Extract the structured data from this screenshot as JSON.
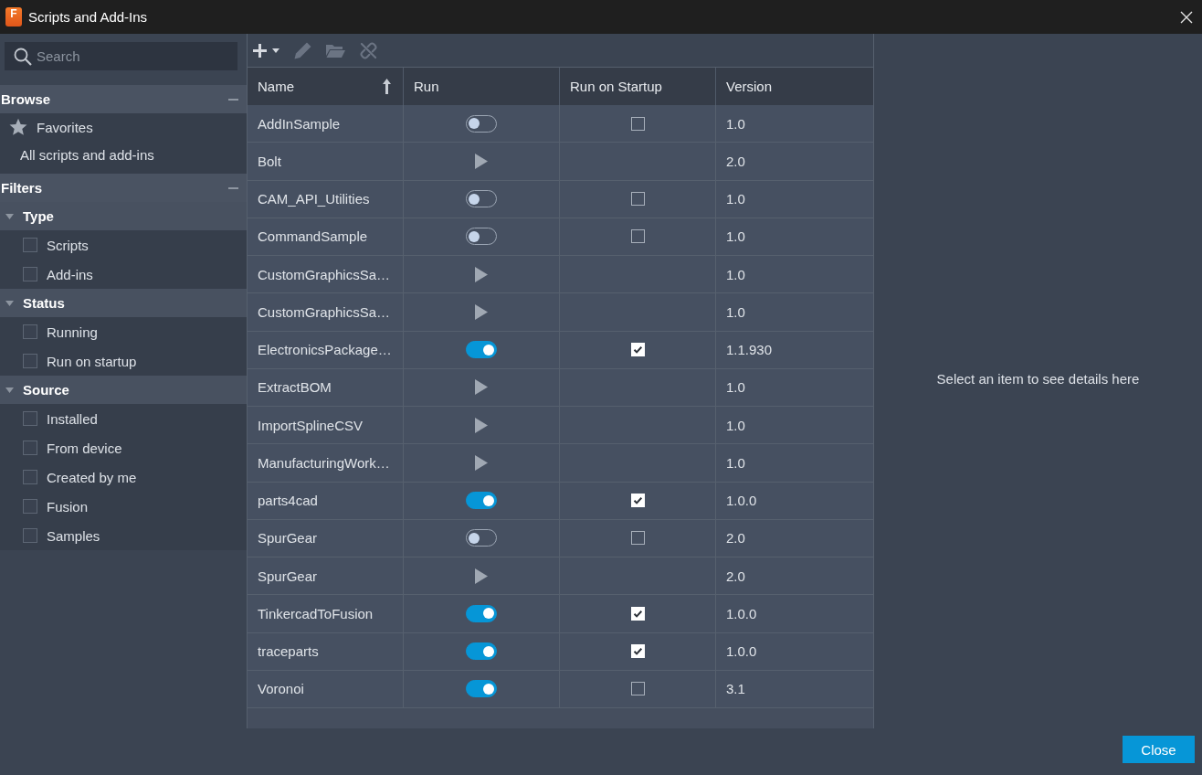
{
  "window": {
    "title": "Scripts and Add-Ins",
    "app_icon_letter": "F"
  },
  "sidebar": {
    "search": {
      "placeholder": "Search"
    },
    "browse": {
      "title": "Browse",
      "expanded": true,
      "items": [
        {
          "label": "Favorites",
          "kind": "favorites"
        },
        {
          "label": "All scripts and add-ins",
          "kind": "all"
        }
      ]
    },
    "filters": {
      "title": "Filters",
      "expanded": true,
      "groups": [
        {
          "title": "Type",
          "expanded": true,
          "items": [
            {
              "label": "Scripts",
              "checked": false
            },
            {
              "label": "Add-ins",
              "checked": false
            }
          ]
        },
        {
          "title": "Status",
          "expanded": true,
          "items": [
            {
              "label": "Running",
              "checked": false
            },
            {
              "label": "Run on startup",
              "checked": false
            }
          ]
        },
        {
          "title": "Source",
          "expanded": true,
          "items": [
            {
              "label": "Installed",
              "checked": false
            },
            {
              "label": "From device",
              "checked": false
            },
            {
              "label": "Created by me",
              "checked": false
            },
            {
              "label": "Fusion",
              "checked": false
            },
            {
              "label": "Samples",
              "checked": false
            }
          ]
        }
      ]
    }
  },
  "toolbar": {
    "buttons": [
      {
        "kind": "add",
        "disabled": false
      },
      {
        "kind": "edit",
        "disabled": true
      },
      {
        "kind": "open",
        "disabled": true
      },
      {
        "kind": "unlink",
        "disabled": true
      }
    ]
  },
  "table": {
    "columns": [
      {
        "label": "Name",
        "sorted": true
      },
      {
        "label": "Run",
        "sorted": false
      },
      {
        "label": "Run on Startup",
        "sorted": false
      },
      {
        "label": "Version",
        "sorted": false
      }
    ],
    "rows": [
      {
        "name": "AddInSample",
        "kind": "addin",
        "running": false,
        "run_on_startup": false,
        "version": "1.0"
      },
      {
        "name": "Bolt",
        "kind": "script",
        "version": "2.0"
      },
      {
        "name": "CAM_API_Utilities",
        "kind": "addin",
        "running": false,
        "run_on_startup": false,
        "version": "1.0"
      },
      {
        "name": "CommandSample",
        "kind": "addin",
        "running": false,
        "run_on_startup": false,
        "version": "1.0"
      },
      {
        "name": "CustomGraphicsSa…",
        "kind": "script",
        "version": "1.0"
      },
      {
        "name": "CustomGraphicsSa…",
        "kind": "script",
        "version": "1.0"
      },
      {
        "name": "ElectronicsPackage…",
        "kind": "addin",
        "running": true,
        "run_on_startup": true,
        "version": "1.1.930"
      },
      {
        "name": "ExtractBOM",
        "kind": "script",
        "version": "1.0"
      },
      {
        "name": "ImportSplineCSV",
        "kind": "script",
        "version": "1.0"
      },
      {
        "name": "ManufacturingWork…",
        "kind": "script",
        "version": "1.0"
      },
      {
        "name": "parts4cad",
        "kind": "addin",
        "running": true,
        "run_on_startup": true,
        "version": "1.0.0"
      },
      {
        "name": "SpurGear",
        "kind": "addin",
        "running": false,
        "run_on_startup": false,
        "version": "2.0"
      },
      {
        "name": "SpurGear",
        "kind": "script",
        "version": "2.0"
      },
      {
        "name": "TinkercadToFusion",
        "kind": "addin",
        "running": true,
        "run_on_startup": true,
        "version": "1.0.0"
      },
      {
        "name": "traceparts",
        "kind": "addin",
        "running": true,
        "run_on_startup": true,
        "version": "1.0.0"
      },
      {
        "name": "Voronoi",
        "kind": "addin",
        "running": true,
        "run_on_startup": false,
        "version": "3.1"
      }
    ]
  },
  "details": {
    "message": "Select an item to see details here"
  },
  "footer": {
    "buttons": [
      "Close"
    ]
  }
}
